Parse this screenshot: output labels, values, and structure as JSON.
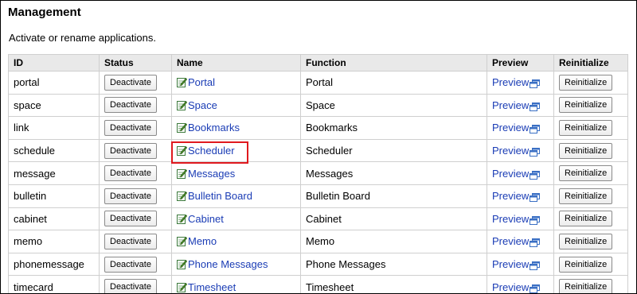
{
  "page": {
    "title": "Management",
    "description": "Activate or rename applications."
  },
  "table": {
    "headers": [
      "ID",
      "Status",
      "Name",
      "Function",
      "Preview",
      "Reinitialize"
    ],
    "rows": [
      {
        "id": "portal",
        "status": "Deactivate",
        "name": "Portal",
        "function": "Portal",
        "preview": "Preview",
        "reinit": "Reinitialize"
      },
      {
        "id": "space",
        "status": "Deactivate",
        "name": "Space",
        "function": "Space",
        "preview": "Preview",
        "reinit": "Reinitialize"
      },
      {
        "id": "link",
        "status": "Deactivate",
        "name": "Bookmarks",
        "function": "Bookmarks",
        "preview": "Preview",
        "reinit": "Reinitialize"
      },
      {
        "id": "schedule",
        "status": "Deactivate",
        "name": "Scheduler",
        "function": "Scheduler",
        "preview": "Preview",
        "reinit": "Reinitialize"
      },
      {
        "id": "message",
        "status": "Deactivate",
        "name": "Messages",
        "function": "Messages",
        "preview": "Preview",
        "reinit": "Reinitialize"
      },
      {
        "id": "bulletin",
        "status": "Deactivate",
        "name": "Bulletin Board",
        "function": "Bulletin Board",
        "preview": "Preview",
        "reinit": "Reinitialize"
      },
      {
        "id": "cabinet",
        "status": "Deactivate",
        "name": "Cabinet",
        "function": "Cabinet",
        "preview": "Preview",
        "reinit": "Reinitialize"
      },
      {
        "id": "memo",
        "status": "Deactivate",
        "name": "Memo",
        "function": "Memo",
        "preview": "Preview",
        "reinit": "Reinitialize"
      },
      {
        "id": "phonemessage",
        "status": "Deactivate",
        "name": "Phone Messages",
        "function": "Phone Messages",
        "preview": "Preview",
        "reinit": "Reinitialize"
      },
      {
        "id": "timecard",
        "status": "Deactivate",
        "name": "Timesheet",
        "function": "Timesheet",
        "preview": "Preview",
        "reinit": "Reinitialize"
      }
    ]
  },
  "icons": {
    "edit": "edit-name-icon",
    "preview_window": "new-window-icon"
  },
  "colors": {
    "link": "#1a3cb5",
    "header_bg": "#e9e9e9",
    "highlight": "#e0191e"
  }
}
